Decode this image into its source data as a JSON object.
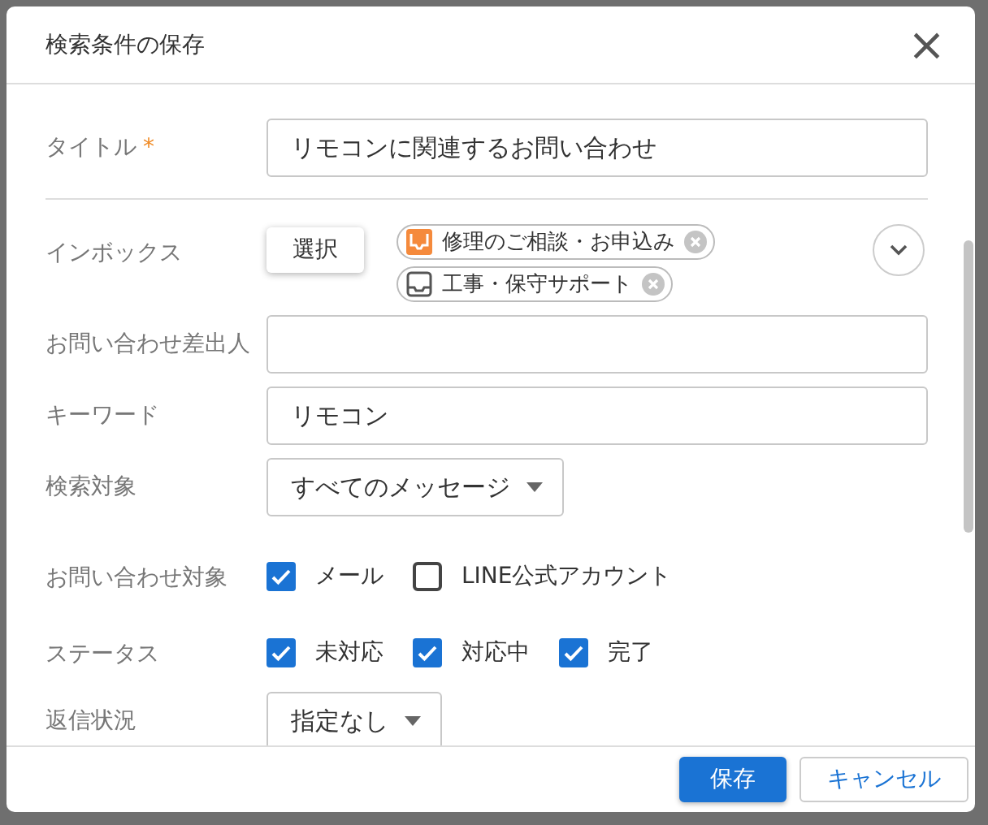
{
  "dialog": {
    "title": "検索条件の保存",
    "close": "×",
    "fields": [
      {
        "kind": "text",
        "label": "タイトル",
        "required_mark": "*",
        "value": "リモコンに関連するお問い合わせ"
      },
      {
        "kind": "inbox",
        "label": "インボックス",
        "button": "選択",
        "chips": [
          {
            "label": "修理のご相談・お申込み",
            "color": "#f58a3c"
          },
          {
            "label": "工事・保守サポート",
            "color": "#555555"
          }
        ]
      },
      {
        "kind": "text",
        "label": "お問い合わせ差出人"
      },
      {
        "kind": "text",
        "label": "キーワード",
        "value": "リモコン"
      },
      {
        "kind": "select",
        "label": "検索対象",
        "value": "すべてのメッセージ"
      },
      {
        "kind": "checks",
        "label": "お問い合わせ対象",
        "options": [
          {
            "label": "メール",
            "checked": true
          },
          {
            "label": "LINE公式アカウント",
            "checked": false
          }
        ]
      },
      {
        "kind": "checks",
        "label": "ステータス",
        "options": [
          {
            "label": "未対応",
            "checked": true
          },
          {
            "label": "対応中",
            "checked": true
          },
          {
            "label": "完了",
            "checked": true
          }
        ]
      },
      {
        "kind": "select",
        "label": "返信状況",
        "value": "指定なし"
      }
    ],
    "buttons": [
      {
        "label": "保存",
        "kind": "primary"
      },
      {
        "label": "キャンセル",
        "kind": "secondary"
      }
    ]
  }
}
